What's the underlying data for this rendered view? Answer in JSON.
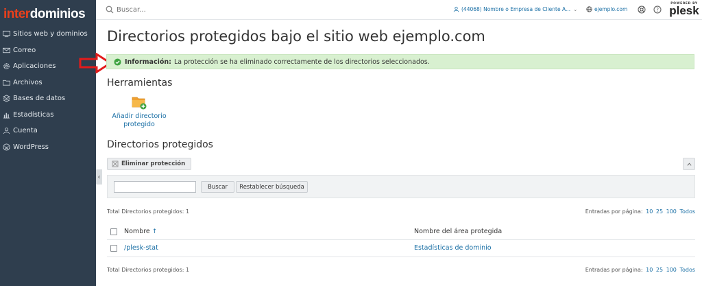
{
  "brand": {
    "part1": "inter",
    "part2": "dominios"
  },
  "sidebar": {
    "items": [
      {
        "label": "Sitios web y dominios",
        "icon": "monitor-icon"
      },
      {
        "label": "Correo",
        "icon": "mail-icon"
      },
      {
        "label": "Aplicaciones",
        "icon": "gear-icon"
      },
      {
        "label": "Archivos",
        "icon": "folder-icon"
      },
      {
        "label": "Bases de datos",
        "icon": "database-icon"
      },
      {
        "label": "Estadísticas",
        "icon": "bar-chart-icon"
      },
      {
        "label": "Cuenta",
        "icon": "user-icon"
      },
      {
        "label": "WordPress",
        "icon": "wordpress-icon"
      }
    ]
  },
  "topbar": {
    "search_placeholder": "Buscar...",
    "account": "(44068) Nombre o Empresa de Cliente A...",
    "domain": "ejemplo.com",
    "plesk_powered": "POWERED BY",
    "plesk_name": "plesk"
  },
  "page": {
    "title": "Directorios protegidos bajo el sitio web ejemplo.com"
  },
  "message": {
    "label": "Información:",
    "text": "La protección se ha eliminado correctamente de los directorios seleccionados."
  },
  "tools": {
    "title": "Herramientas",
    "add_line1": "Añadir directorio",
    "add_line2": "protegido"
  },
  "list": {
    "title": "Directorios protegidos",
    "remove_button": "Eliminar protección",
    "search_button": "Buscar",
    "reset_button": "Restablecer búsqueda",
    "totals": "Total Directorios protegidos: 1",
    "entries_label": "Entradas por página:",
    "page_sizes": [
      "10",
      "25",
      "100",
      "Todos"
    ],
    "columns": [
      "Nombre",
      "Nombre del área protegida"
    ],
    "rows": [
      {
        "name": "/plesk-stat",
        "area": "Estadísticas de dominio"
      }
    ]
  },
  "colors": {
    "sidebar_bg": "#2f3e4e",
    "brand_accent": "#e8401c",
    "link": "#1a6fa5",
    "success_bg": "#d8f0d0",
    "success_icon": "#3ea341",
    "annotation_arrow": "#e31b1b"
  }
}
